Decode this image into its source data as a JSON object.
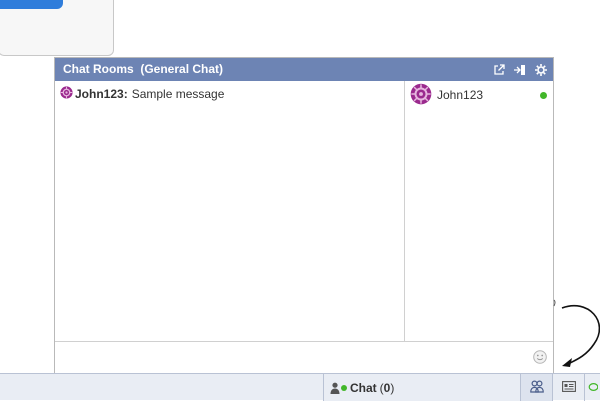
{
  "chat_window": {
    "title": "Chat Rooms  (General Chat)",
    "header_icons": [
      "popout-icon",
      "leave-room-icon",
      "settings-gear-icon"
    ]
  },
  "messages": [
    {
      "sender": "John123",
      "text": "Sample message"
    }
  ],
  "users": [
    {
      "name": "John123",
      "status": "online"
    }
  ],
  "input": {
    "value": "",
    "placeholder": ""
  },
  "dock": {
    "chat_label": "Chat",
    "chat_count_open": "(",
    "chat_count": "0",
    "chat_count_close": ")"
  },
  "colors": {
    "header_bg": "#6d84b4",
    "online": "#42b72a",
    "avatar": "#9b2a8e",
    "dock_bg": "#e9edf4"
  }
}
